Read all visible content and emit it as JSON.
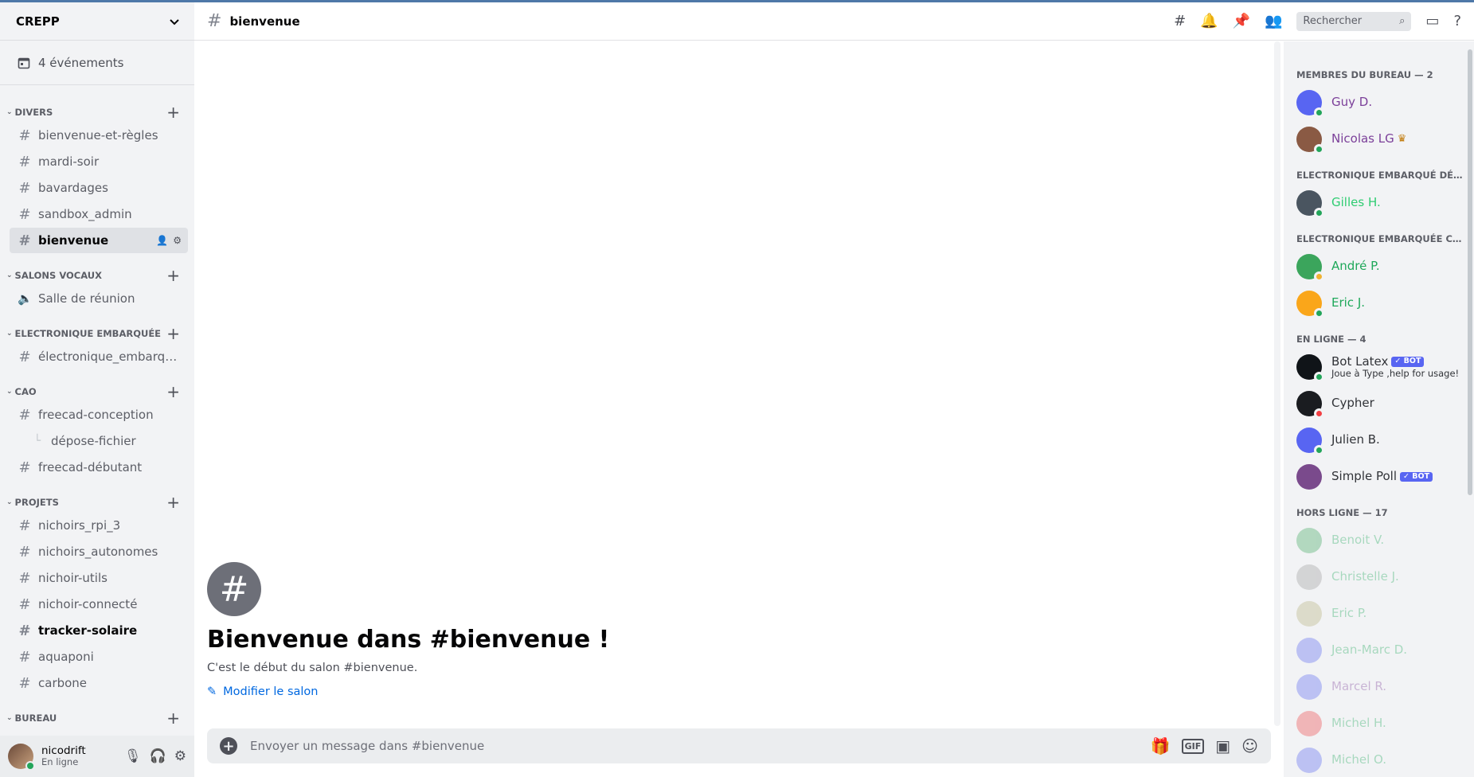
{
  "guild": {
    "name": "CREPP"
  },
  "events": {
    "label": "4 événements"
  },
  "categories": [
    {
      "name": "DIVERS",
      "channels": [
        "bienvenue-et-règles",
        "mardi-soir",
        "bavardages",
        "sandbox_admin",
        "bienvenue"
      ]
    },
    {
      "name": "SALONS VOCAUX",
      "channels": [
        "Salle de réunion"
      ]
    },
    {
      "name": "ELECTRONIQUE EMBARQUÉE",
      "channels": [
        "électronique_embarqué..."
      ]
    },
    {
      "name": "CAO",
      "channels": [
        "freecad-conception",
        "dépose-fichier",
        "freecad-débutant"
      ]
    },
    {
      "name": "PROJETS",
      "channels": [
        "nichoirs_rpi_3",
        "nichoirs_autonomes",
        "nichoir-utils",
        "nichoir-connecté",
        "tracker-solaire",
        "aquaponi",
        "carbone"
      ]
    },
    {
      "name": "BUREAU",
      "channels": []
    }
  ],
  "user": {
    "name": "nicodrift",
    "status": "En ligne"
  },
  "header": {
    "channel": "bienvenue",
    "search_placeholder": "Rechercher"
  },
  "welcome": {
    "title": "Bienvenue dans #bienvenue !",
    "desc": "C'est le début du salon #bienvenue.",
    "edit": "Modifier le salon"
  },
  "composer": {
    "placeholder": "Envoyer un message dans #bienvenue",
    "gif": "GIF"
  },
  "members": {
    "sections": [
      {
        "title": "MEMBRES DU BUREAU — 2",
        "items": [
          {
            "name": "Guy D.",
            "color": "#7b3f99",
            "av": "#5865f2",
            "st": "online"
          },
          {
            "name": "Nicolas LG",
            "color": "#7b3f99",
            "av": "#8a5a44",
            "st": "online",
            "crown": true
          }
        ]
      },
      {
        "title": "ELECTRONIQUE EMBARQUÉ DÉBUT...",
        "items": [
          {
            "name": "Gilles H.",
            "color": "#2ecc71",
            "av": "#4a5560",
            "st": "online"
          }
        ]
      },
      {
        "title": "ELECTRONIQUE EMBARQUÉE CON...",
        "items": [
          {
            "name": "André P.",
            "color": "#1fa85a",
            "av": "#3ba55c",
            "st": "idle"
          },
          {
            "name": "Eric J.",
            "color": "#1fa85a",
            "av": "#faa61a",
            "st": "online"
          }
        ]
      },
      {
        "title": "EN LIGNE — 4",
        "items": [
          {
            "name": "Bot Latex",
            "color": "#313338",
            "av": "#101418",
            "st": "online",
            "bot": "✓ BOT",
            "activity": "Joue à Type ,help for usage!"
          },
          {
            "name": "Cypher",
            "color": "#313338",
            "av": "#1a1c20",
            "st": "dnd"
          },
          {
            "name": "Julien B.",
            "color": "#313338",
            "av": "#5865f2",
            "st": "online"
          },
          {
            "name": "Simple Poll",
            "color": "#313338",
            "av": "#7a4a8c",
            "st": "none",
            "bot": "✓ BOT"
          }
        ]
      },
      {
        "title": "HORS LIGNE — 17",
        "offline": true,
        "items": [
          {
            "name": "Benoit V.",
            "color": "#1fa85a",
            "av": "#3ba55c"
          },
          {
            "name": "Christelle J.",
            "color": "#1fa85a",
            "av": "#9a9a9a"
          },
          {
            "name": "Eric P.",
            "color": "#1fa85a",
            "av": "#b5b07a"
          },
          {
            "name": "Jean-Marc D.",
            "color": "#1fa85a",
            "av": "#5865f2"
          },
          {
            "name": "Marcel R.",
            "color": "#7b3f99",
            "av": "#5865f2"
          },
          {
            "name": "Michel H.",
            "color": "#1fa85a",
            "av": "#ed4245"
          },
          {
            "name": "Michel O.",
            "color": "#1fa85a",
            "av": "#5865f2"
          }
        ]
      }
    ]
  }
}
